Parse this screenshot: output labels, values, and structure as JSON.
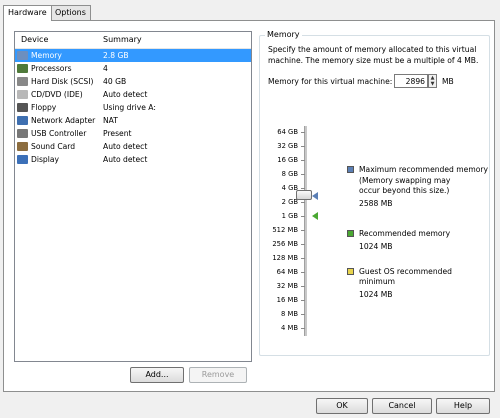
{
  "tabs": [
    "Hardware",
    "Options"
  ],
  "device_list": {
    "headers": {
      "device": "Device",
      "summary": "Summary"
    },
    "rows": [
      {
        "device": "Memory",
        "summary": "2.8 GB",
        "icon": "memory-icon",
        "selected": true
      },
      {
        "device": "Processors",
        "summary": "4",
        "icon": "processor-icon"
      },
      {
        "device": "Hard Disk (SCSI)",
        "summary": "40 GB",
        "icon": "hard-disk-icon"
      },
      {
        "device": "CD/DVD (IDE)",
        "summary": "Auto detect",
        "icon": "cd-dvd-icon"
      },
      {
        "device": "Floppy",
        "summary": "Using drive A:",
        "icon": "floppy-icon"
      },
      {
        "device": "Network Adapter",
        "summary": "NAT",
        "icon": "network-adapter-icon"
      },
      {
        "device": "USB Controller",
        "summary": "Present",
        "icon": "usb-controller-icon"
      },
      {
        "device": "Sound Card",
        "summary": "Auto detect",
        "icon": "sound-card-icon"
      },
      {
        "device": "Display",
        "summary": "Auto detect",
        "icon": "display-icon"
      }
    ]
  },
  "buttons": {
    "add": "Add...",
    "remove": "Remove",
    "ok": "OK",
    "cancel": "Cancel",
    "help": "Help"
  },
  "memory": {
    "title": "Memory",
    "description": "Specify the amount of memory allocated to this virtual machine. The memory size must be a multiple of 4 MB.",
    "field_label": "Memory for this virtual machine:",
    "value": "2896",
    "unit": "MB",
    "scale_labels": [
      "64 GB",
      "32 GB",
      "16 GB",
      "8 GB",
      "4 GB",
      "2 GB",
      "1 GB",
      "512 MB",
      "256 MB",
      "128 MB",
      "64 MB",
      "32 MB",
      "16 MB",
      "8 MB",
      "4 MB"
    ],
    "legend": {
      "max": {
        "label": "Maximum recommended memory",
        "note": "(Memory swapping may occur beyond this size.)",
        "value": "2588 MB",
        "color": "#5b7fb5"
      },
      "recommended": {
        "label": "Recommended memory",
        "value": "1024 MB",
        "color": "#4aa832"
      },
      "guest": {
        "label": "Guest OS recommended minimum",
        "value": "1024 MB",
        "color": "#e8d44d"
      }
    }
  }
}
